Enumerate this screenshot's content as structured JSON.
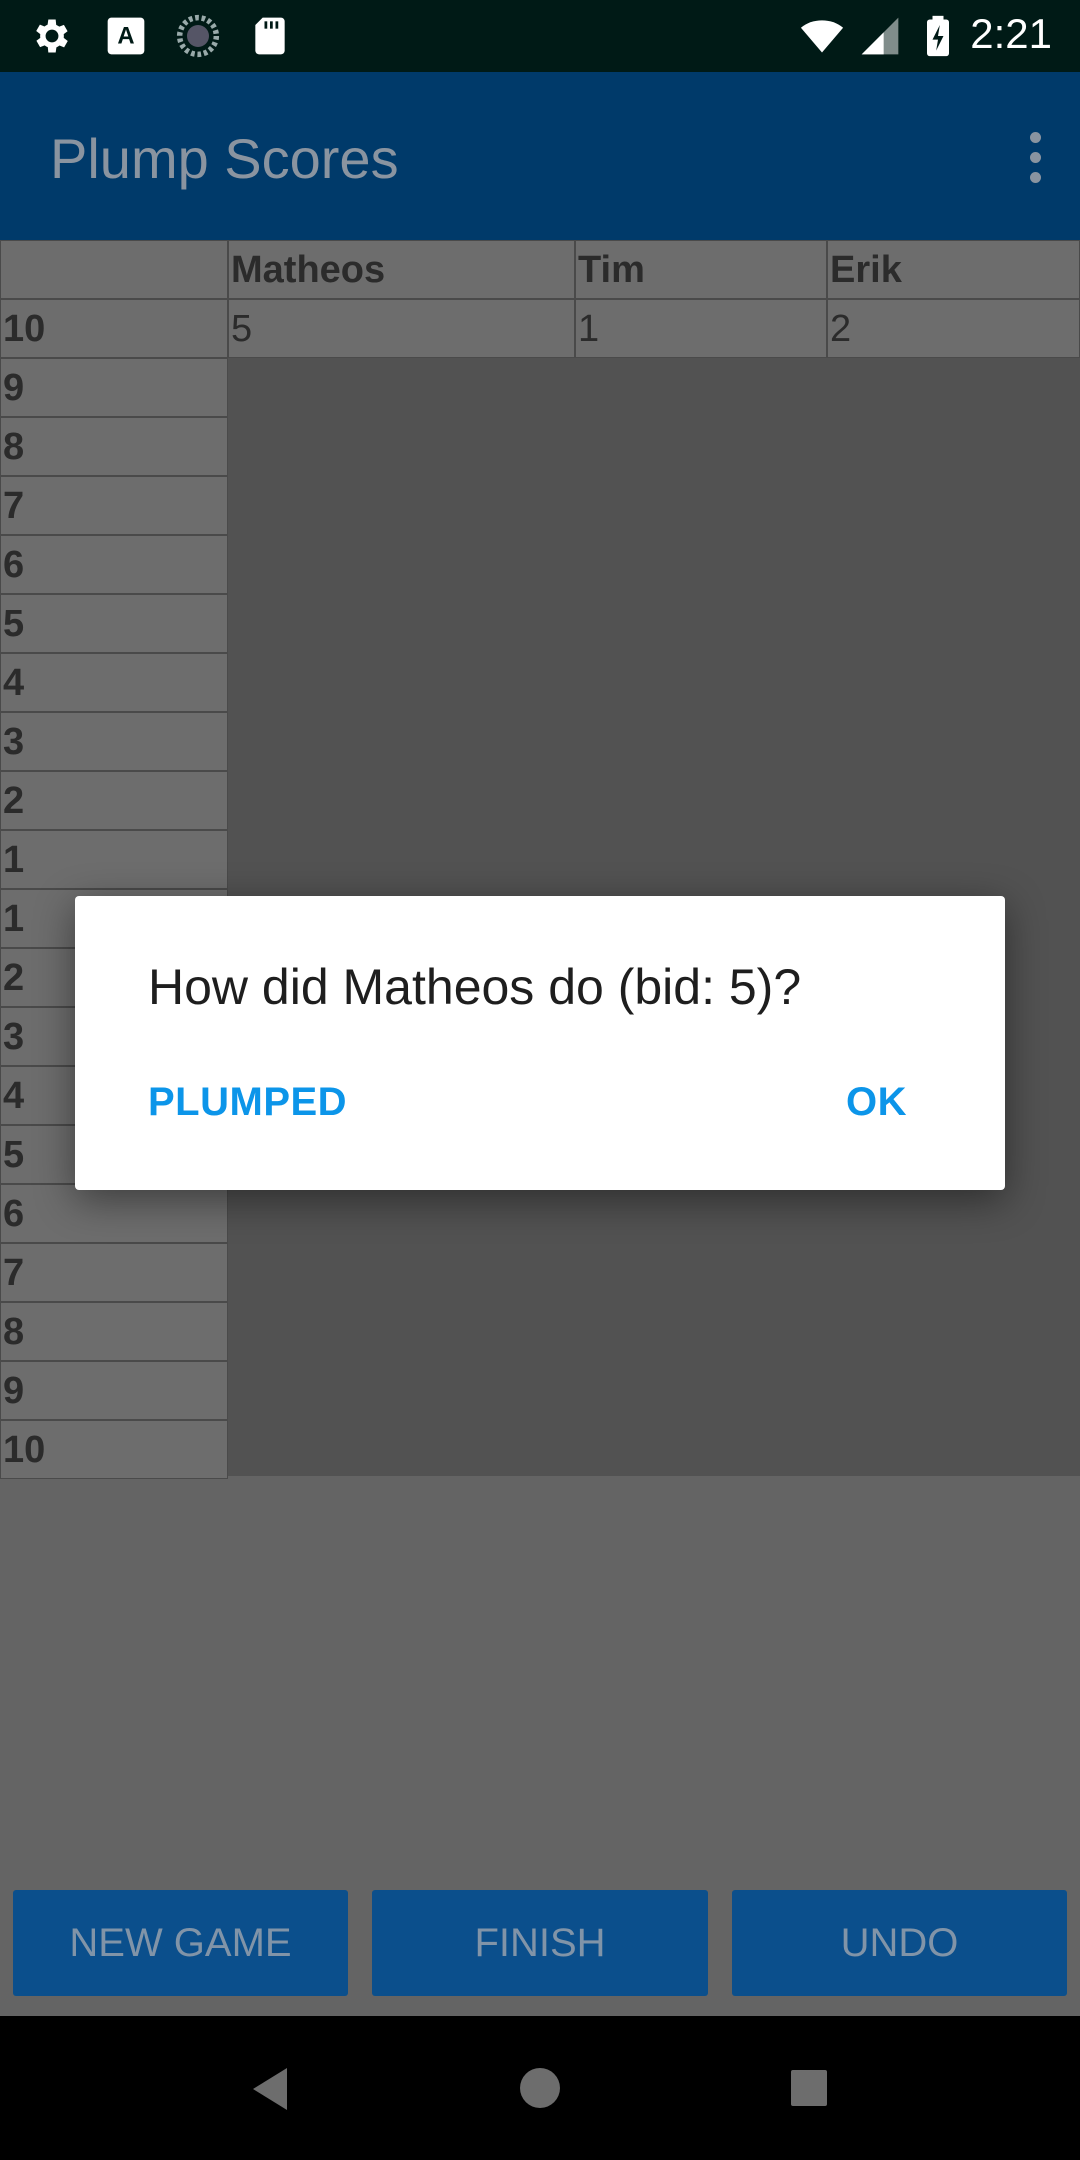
{
  "status_bar": {
    "time": "2:21",
    "left_icons": [
      "gear-icon",
      "font-a-icon",
      "spinner-icon",
      "sd-card-icon"
    ],
    "right_icons": [
      "wifi-icon",
      "signal-icon",
      "battery-charging-icon"
    ]
  },
  "app_bar": {
    "title": "Plump Scores",
    "menu_icon": "more-vert-icon"
  },
  "grid": {
    "players": [
      "Matheos",
      "Tim",
      "Erik"
    ],
    "rounds": [
      "10",
      "9",
      "8",
      "7",
      "6",
      "5",
      "4",
      "3",
      "2",
      "1",
      "1",
      "2",
      "3",
      "4",
      "5",
      "6",
      "7",
      "8",
      "9",
      "10"
    ],
    "first_row_values": [
      "5",
      "1",
      "2"
    ]
  },
  "buttons": {
    "new_game": "NEW GAME",
    "finish": "FINISH",
    "undo": "UNDO"
  },
  "dialog": {
    "title": "How did Matheos do (bid: 5)?",
    "negative": "PLUMPED",
    "positive": "OK"
  },
  "colors": {
    "app_bar": "#003a6a",
    "button": "#0b4f8c",
    "dialog_accent": "#0c95e9"
  }
}
